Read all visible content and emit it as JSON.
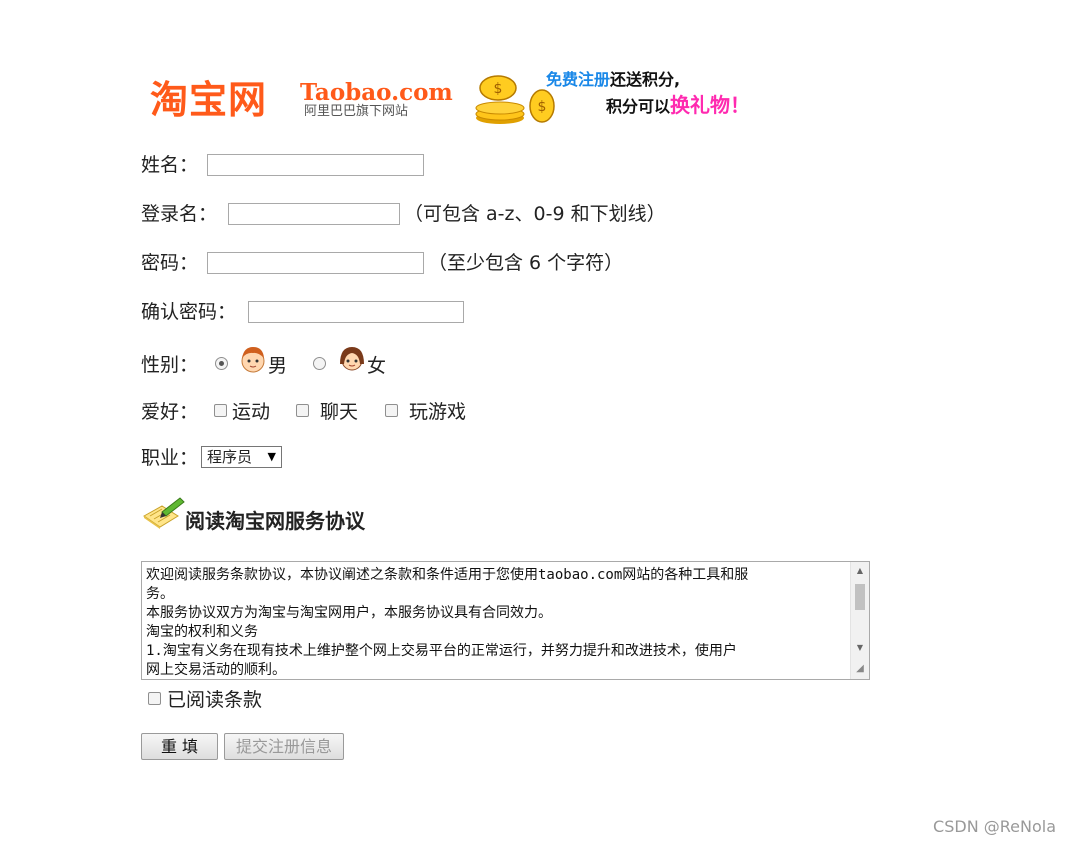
{
  "header": {
    "logo_cn": "淘宝网",
    "logo_en": "Taobao.com",
    "logo_sub": "阿里巴巴旗下网站",
    "promo_line1_blue": "免费注册",
    "promo_line1_black": "还送积分,",
    "promo_line2_black": "积分可以",
    "promo_line2_pink": "换礼物！"
  },
  "form": {
    "name_label": "姓名：",
    "login_label": "登录名：",
    "login_hint": "（可包含 a-z、0-9 和下划线）",
    "password_label": "密码：",
    "password_hint": "（至少包含 6 个字符）",
    "confirm_label": "确认密码：",
    "gender_label": "性别：",
    "gender_options": [
      "男",
      "女"
    ],
    "gender_selected": "男",
    "hobby_label": "爱好：",
    "hobbies": [
      "运动",
      "聊天",
      "玩游戏"
    ],
    "job_label": "职业：",
    "job_selected": "程序员"
  },
  "agreement": {
    "title": "阅读淘宝网服务协议",
    "lines": [
      "欢迎阅读服务条款协议，本协议阐述之条款和条件适用于您使用taobao.com网站的各种工具和服",
      "务。",
      "本服务协议双方为淘宝与淘宝网用户，本服务协议具有合同效力。",
      "淘宝的权利和义务",
      "1.淘宝有义务在现有技术上维护整个网上交易平台的正常运行，并努力提升和改进技术，使用户",
      "网上交易活动的顺利。"
    ],
    "read_label": "已阅读条款"
  },
  "buttons": {
    "reset_label": "重 填",
    "submit_label": "提交注册信息"
  },
  "watermark": "CSDN @ReNola",
  "colors": {
    "brand_orange": "#ff5a1a",
    "promo_blue": "#1a88e8",
    "promo_pink": "#ff2ab0"
  }
}
